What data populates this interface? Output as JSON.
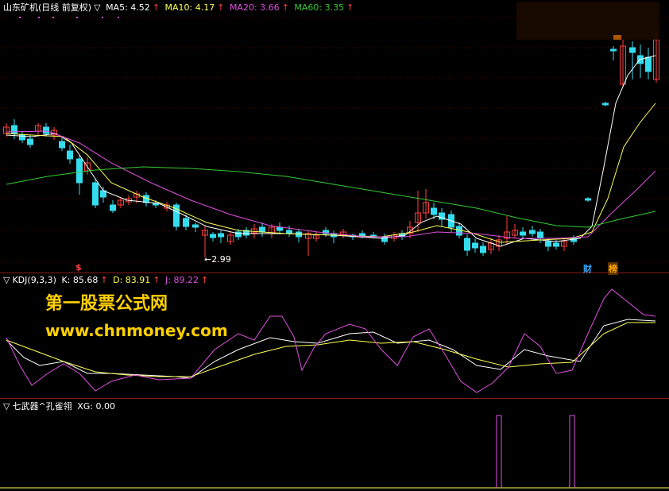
{
  "main_panel": {
    "title": "山东矿机(日线 前复权)",
    "ma": [
      {
        "label": "MA5: 4.52",
        "color": "#ffffff"
      },
      {
        "label": "MA10: 4.17",
        "color": "#ffff55"
      },
      {
        "label": "MA20: 3.66",
        "color": "#e050e0"
      },
      {
        "label": "MA60: 3.35",
        "color": "#33cc33"
      }
    ],
    "low_marker": "←2.99",
    "signal_mark": "$",
    "tag_cai": "财",
    "tag_bang": "榜"
  },
  "kdj_panel": {
    "title": "KDJ(9,3,3)",
    "values": [
      {
        "label": "K: 85.68",
        "color": "#ffffff"
      },
      {
        "label": "D: 83.91",
        "color": "#ffff55"
      },
      {
        "label": "J: 89.22",
        "color": "#e050e0"
      }
    ]
  },
  "xg_panel": {
    "title": "七武器^孔雀翎",
    "value": "XG: 0.00"
  },
  "watermark": {
    "line1": "第一股票公式网",
    "line2": "www.chnmoney.com"
  },
  "colors": {
    "up": "#ff4040",
    "down": "#33ddee",
    "ma5": "#ffffff",
    "ma10": "#ffff55",
    "ma20": "#e050e0",
    "ma60": "#33cc33",
    "separator": "#8b1a1a",
    "watermark": "#ffd000"
  }
}
